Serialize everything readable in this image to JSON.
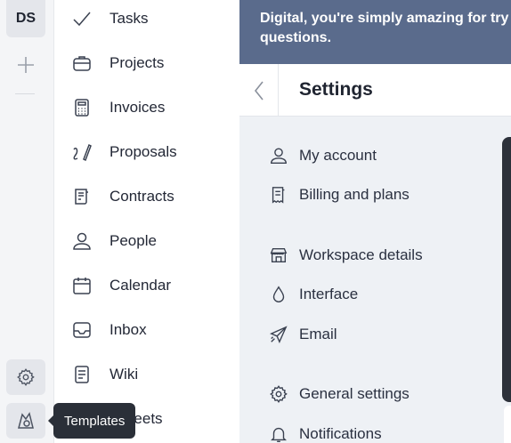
{
  "rail": {
    "avatar_initials": "DS"
  },
  "nav": {
    "items": [
      {
        "label": "Tasks",
        "icon": "check-icon"
      },
      {
        "label": "Projects",
        "icon": "briefcase-icon"
      },
      {
        "label": "Invoices",
        "icon": "calculator-icon"
      },
      {
        "label": "Proposals",
        "icon": "pen-icon"
      },
      {
        "label": "Contracts",
        "icon": "contract-icon"
      },
      {
        "label": "People",
        "icon": "person-icon"
      },
      {
        "label": "Calendar",
        "icon": "calendar-icon"
      },
      {
        "label": "Inbox",
        "icon": "inbox-icon"
      },
      {
        "label": "Wiki",
        "icon": "document-icon"
      },
      {
        "label": "esheets",
        "icon": "timesheet-icon"
      }
    ]
  },
  "tooltip": {
    "text": "Templates"
  },
  "banner": {
    "line1": "Digital, you're simply amazing for try",
    "line2": "questions."
  },
  "settings": {
    "title": "Settings",
    "items": [
      {
        "label": "My account",
        "icon": "user-icon"
      },
      {
        "label": "Billing and plans",
        "icon": "receipt-icon"
      },
      {
        "label": "Workspace details",
        "icon": "store-icon"
      },
      {
        "label": "Interface",
        "icon": "drop-icon"
      },
      {
        "label": "Email",
        "icon": "send-icon"
      },
      {
        "label": "General settings",
        "icon": "gear-icon"
      },
      {
        "label": "Notifications",
        "icon": "bell-icon"
      }
    ]
  }
}
